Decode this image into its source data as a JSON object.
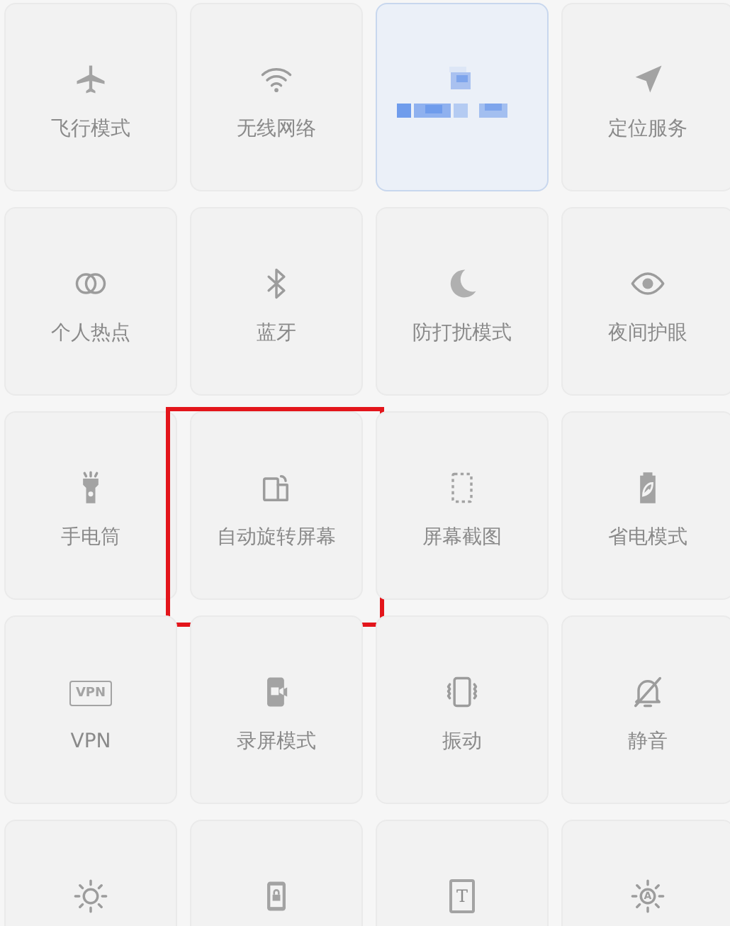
{
  "tiles": [
    {
      "kind": "airplane",
      "label": "飞行模式",
      "selected": false,
      "annotated": false
    },
    {
      "kind": "wifi",
      "label": "无线网络",
      "selected": false,
      "annotated": false
    },
    {
      "kind": "pixelated",
      "selected": true,
      "annotated": false
    },
    {
      "kind": "location",
      "label": "定位服务",
      "selected": false,
      "annotated": false
    },
    {
      "kind": "rings",
      "label": "个人热点",
      "selected": false,
      "annotated": false
    },
    {
      "kind": "bluetooth",
      "label": "蓝牙",
      "selected": false,
      "annotated": false
    },
    {
      "kind": "moon",
      "label": "防打扰模式",
      "selected": false,
      "annotated": false
    },
    {
      "kind": "eye",
      "label": "夜间护眼",
      "selected": false,
      "annotated": false
    },
    {
      "kind": "flashlight",
      "label": "手电筒",
      "selected": false,
      "annotated": false
    },
    {
      "kind": "rotate",
      "label": "自动旋转屏幕",
      "selected": false,
      "annotated": true
    },
    {
      "kind": "dashed",
      "label": "屏幕截图",
      "selected": false,
      "annotated": false
    },
    {
      "kind": "battery",
      "label": "省电模式",
      "selected": false,
      "annotated": false
    },
    {
      "kind": "textbadge",
      "icon_text": "VPN",
      "label": "VPN",
      "selected": false,
      "annotated": false
    },
    {
      "kind": "record",
      "label": "录屏模式",
      "selected": false,
      "annotated": false
    },
    {
      "kind": "vibrate",
      "label": "振动",
      "selected": false,
      "annotated": false
    },
    {
      "kind": "bell-off",
      "label": "静音",
      "selected": false,
      "annotated": false
    },
    {
      "kind": "sun",
      "selected": false,
      "annotated": false
    },
    {
      "kind": "phone-lock",
      "selected": false,
      "annotated": false
    },
    {
      "kind": "textframe",
      "icon_text": "T",
      "selected": false,
      "annotated": false
    },
    {
      "kind": "sun-text",
      "icon_text": "A",
      "selected": false,
      "annotated": false
    }
  ]
}
